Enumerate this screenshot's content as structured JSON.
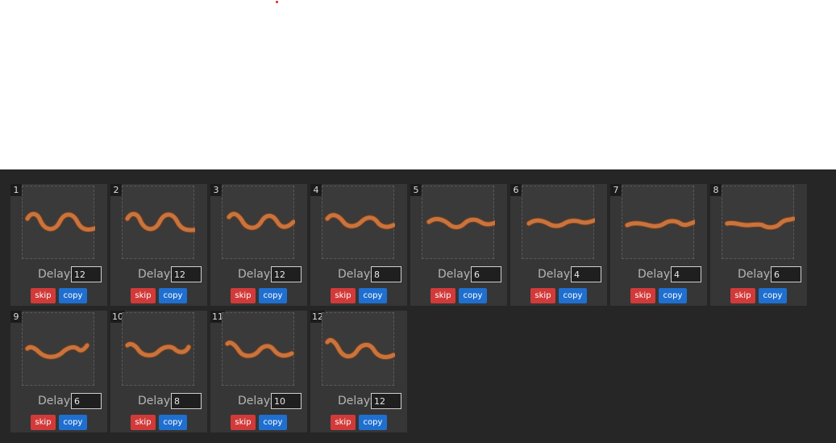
{
  "labels": {
    "delay": "Delay:",
    "skip": "skip",
    "copy": "copy"
  },
  "colors": {
    "skip_button": "#d23a3a",
    "copy_button": "#1f6fd0",
    "snake": "#c8743e",
    "panel": "#262626"
  },
  "frames": [
    {
      "index": "1",
      "delay": "12",
      "image": "snake-frame-icon"
    },
    {
      "index": "2",
      "delay": "12",
      "image": "snake-frame-icon"
    },
    {
      "index": "3",
      "delay": "12",
      "image": "snake-frame-icon"
    },
    {
      "index": "4",
      "delay": "8",
      "image": "snake-frame-icon"
    },
    {
      "index": "5",
      "delay": "6",
      "image": "snake-frame-icon"
    },
    {
      "index": "6",
      "delay": "4",
      "image": "snake-frame-icon"
    },
    {
      "index": "7",
      "delay": "4",
      "image": "snake-frame-icon"
    },
    {
      "index": "8",
      "delay": "6",
      "image": "snake-frame-icon"
    },
    {
      "index": "9",
      "delay": "6",
      "image": "snake-frame-icon"
    },
    {
      "index": "10",
      "delay": "8",
      "image": "snake-frame-icon"
    },
    {
      "index": "11",
      "delay": "10",
      "image": "snake-frame-icon"
    },
    {
      "index": "12",
      "delay": "12",
      "image": "snake-frame-icon"
    }
  ]
}
